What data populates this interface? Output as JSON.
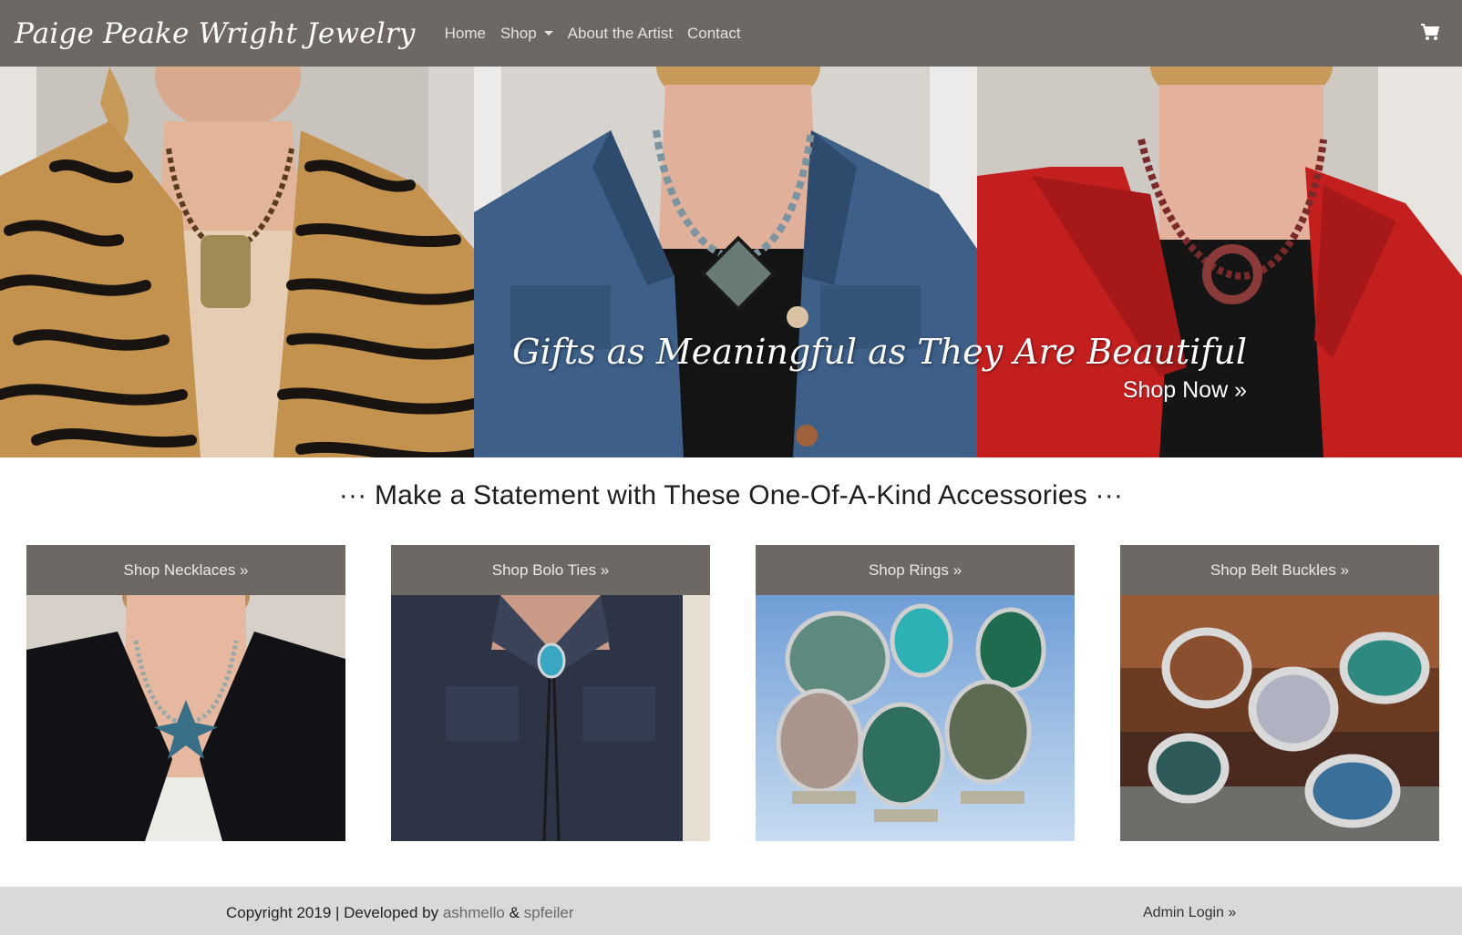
{
  "navbar": {
    "brand": "Paige Peake Wright Jewelry",
    "links": [
      "Home",
      "Shop",
      "About the Artist",
      "Contact"
    ],
    "cart_icon": "shopping-cart-icon"
  },
  "hero": {
    "tagline": "Gifts as Meaningful as They Are Beautiful",
    "cta": "Shop Now »"
  },
  "headline": "··· Make a Statement with These One-Of-A-Kind Accessories ···",
  "categories": [
    {
      "label": "Shop Necklaces »"
    },
    {
      "label": "Shop Bolo Ties »"
    },
    {
      "label": "Shop Rings »"
    },
    {
      "label": "Shop Belt Buckles »"
    }
  ],
  "footer": {
    "copyright": "Copyright 2019 | Developed by ",
    "dev1": "ashmello",
    "amp": " & ",
    "dev2": "spfeiler",
    "admin": "Admin Login »"
  },
  "colors": {
    "nav_bg": "#6e6864",
    "footer_bg": "#d9d9d9",
    "card_header_bg": "#6e6864"
  }
}
